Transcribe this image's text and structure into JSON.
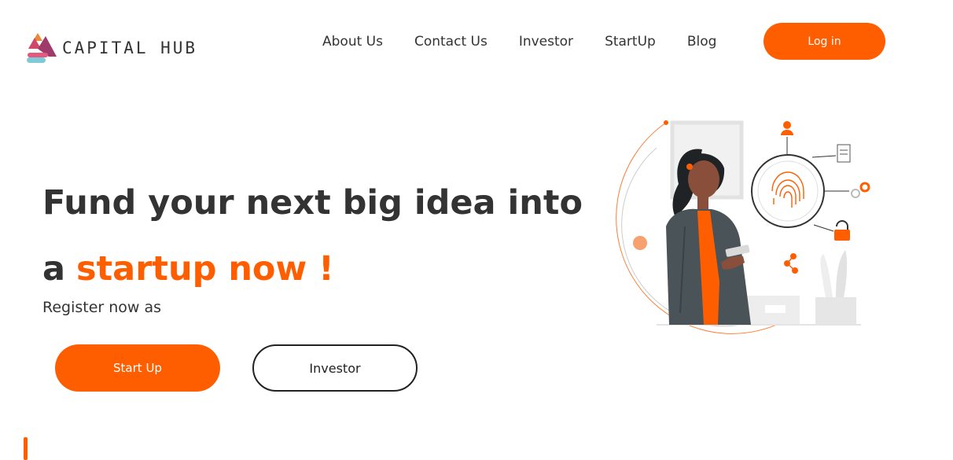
{
  "brand": {
    "name": "CAPITAL HUB",
    "logo_icon": "capital-hub-logo",
    "accent_color": "#ff5e00"
  },
  "nav": {
    "items": [
      {
        "label": "About Us"
      },
      {
        "label": "Contact Us"
      },
      {
        "label": "Investor"
      },
      {
        "label": "StartUp"
      },
      {
        "label": "Blog"
      }
    ],
    "login_label": "Log in"
  },
  "hero": {
    "title_line1": "Fund your next big idea into",
    "title_prefix": "a",
    "title_highlight": "startup now !",
    "subtitle": "Register now as",
    "startup_button": "Start Up",
    "investor_button": "Investor",
    "illustration": "woman-with-phone-fingerprint-security-illustration"
  }
}
